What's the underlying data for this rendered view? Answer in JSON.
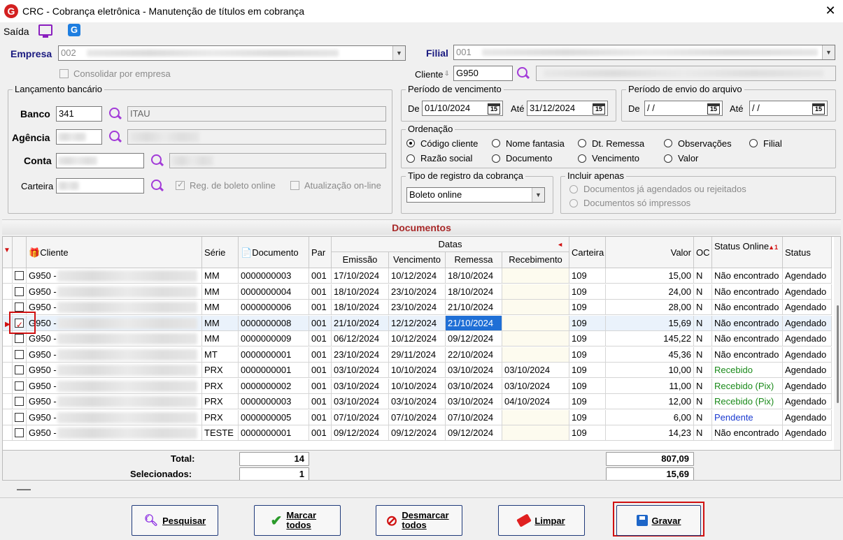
{
  "window": {
    "title": "CRC - Cobrança eletrônica - Manutenção de títulos em cobrança",
    "close": "✕"
  },
  "menu": {
    "saida": "Saída"
  },
  "empresa": {
    "label": "Empresa",
    "value": "002",
    "consolidar": "Consolidar por empresa"
  },
  "filial": {
    "label": "Filial",
    "value": "001",
    "cliente_label": "Cliente",
    "cliente_value": "G950"
  },
  "lancamento": {
    "title": "Lançamento bancário",
    "banco_label": "Banco",
    "banco": "341",
    "banco_nome": "ITAU",
    "agencia_label": "Agência",
    "conta_label": "Conta",
    "carteira_label": "Carteira",
    "reg_boleto": "Reg. de boleto online",
    "atualizacao": "Atualização on-line"
  },
  "vencimento": {
    "title": "Período de vencimento",
    "de_label": "De",
    "de": "01/10/2024",
    "ate_label": "Até",
    "ate": "31/12/2024"
  },
  "envio": {
    "title": "Período de envio do arquivo",
    "de_label": "De",
    "de": " / /",
    "ate_label": "Até",
    "ate": " / /"
  },
  "ordenacao": {
    "title": "Ordenação",
    "opts": [
      "Código cliente",
      "Nome fantasia",
      "Dt. Remessa",
      "Observações",
      "Filial",
      "Razão social",
      "Documento",
      "Vencimento",
      "Valor"
    ]
  },
  "tipo_registro": {
    "title": "Tipo de registro da cobrança",
    "value": "Boleto online"
  },
  "incluir": {
    "title": "Incluir apenas",
    "opt1": "Documentos já agendados ou rejeitados",
    "opt2": "Documentos só impressos"
  },
  "documentos": {
    "title": "Documentos"
  },
  "grid": {
    "headers": {
      "cliente": "Cliente",
      "serie": "Série",
      "documento": "Documento",
      "par": "Par",
      "datas": "Datas",
      "emissao": "Emissão",
      "vencimento": "Vencimento",
      "remessa": "Remessa",
      "recebimento": "Recebimento",
      "carteira": "Carteira",
      "valor": "Valor",
      "oc": "OC",
      "status_online": "Status Online",
      "status": "Status"
    },
    "rows": [
      {
        "cli": "G950 -",
        "serie": "MM",
        "doc": "0000000003",
        "par": "001",
        "emi": "17/10/2024",
        "ven": "10/12/2024",
        "rem": "18/10/2024",
        "rec": "",
        "car": "109",
        "val": "15,00",
        "oc": "N",
        "so": "Não encontrado",
        "st": "Agendado",
        "soc": ""
      },
      {
        "cli": "G950 -",
        "serie": "MM",
        "doc": "0000000004",
        "par": "001",
        "emi": "18/10/2024",
        "ven": "23/10/2024",
        "rem": "18/10/2024",
        "rec": "",
        "car": "109",
        "val": "24,00",
        "oc": "N",
        "so": "Não encontrado",
        "st": "Agendado",
        "soc": ""
      },
      {
        "cli": "G950 -",
        "serie": "MM",
        "doc": "0000000006",
        "par": "001",
        "emi": "18/10/2024",
        "ven": "23/10/2024",
        "rem": "21/10/2024",
        "rec": "",
        "car": "109",
        "val": "28,00",
        "oc": "N",
        "so": "Não encontrado",
        "st": "Agendado",
        "soc": ""
      },
      {
        "cli": "G950 -",
        "serie": "MM",
        "doc": "0000000008",
        "par": "001",
        "emi": "21/10/2024",
        "ven": "12/12/2024",
        "rem": "21/10/2024",
        "rec": "",
        "car": "109",
        "val": "15,69",
        "oc": "N",
        "so": "Não encontrado",
        "st": "Agendado",
        "soc": ""
      },
      {
        "cli": "G950 -",
        "serie": "MM",
        "doc": "0000000009",
        "par": "001",
        "emi": "06/12/2024",
        "ven": "10/12/2024",
        "rem": "09/12/2024",
        "rec": "",
        "car": "109",
        "val": "145,22",
        "oc": "N",
        "so": "Não encontrado",
        "st": "Agendado",
        "soc": ""
      },
      {
        "cli": "G950 -",
        "serie": "MT",
        "doc": "0000000001",
        "par": "001",
        "emi": "23/10/2024",
        "ven": "29/11/2024",
        "rem": "22/10/2024",
        "rec": "",
        "car": "109",
        "val": "45,36",
        "oc": "N",
        "so": "Não encontrado",
        "st": "Agendado",
        "soc": ""
      },
      {
        "cli": "G950 -",
        "serie": "PRX",
        "doc": "0000000001",
        "par": "001",
        "emi": "03/10/2024",
        "ven": "10/10/2024",
        "rem": "03/10/2024",
        "rec": "03/10/2024",
        "car": "109",
        "val": "10,00",
        "oc": "N",
        "so": "Recebido",
        "st": "Agendado",
        "soc": "green"
      },
      {
        "cli": "G950 -",
        "serie": "PRX",
        "doc": "0000000002",
        "par": "001",
        "emi": "03/10/2024",
        "ven": "10/10/2024",
        "rem": "03/10/2024",
        "rec": "03/10/2024",
        "car": "109",
        "val": "11,00",
        "oc": "N",
        "so": "Recebido (Pix)",
        "st": "Agendado",
        "soc": "green"
      },
      {
        "cli": "G950 -",
        "serie": "PRX",
        "doc": "0000000003",
        "par": "001",
        "emi": "03/10/2024",
        "ven": "03/10/2024",
        "rem": "03/10/2024",
        "rec": "04/10/2024",
        "car": "109",
        "val": "12,00",
        "oc": "N",
        "so": "Recebido (Pix)",
        "st": "Agendado",
        "soc": "green"
      },
      {
        "cli": "G950 -",
        "serie": "PRX",
        "doc": "0000000005",
        "par": "001",
        "emi": "07/10/2024",
        "ven": "07/10/2024",
        "rem": "07/10/2024",
        "rec": "",
        "car": "109",
        "val": "6,00",
        "oc": "N",
        "so": "Pendente",
        "st": "Agendado",
        "soc": "blue"
      },
      {
        "cli": "G950 -",
        "serie": "TESTE",
        "doc": "0000000001",
        "par": "001",
        "emi": "09/12/2024",
        "ven": "09/12/2024",
        "rem": "09/12/2024",
        "rec": "",
        "car": "109",
        "val": "14,23",
        "oc": "N",
        "so": "Não encontrado",
        "st": "Agendado",
        "soc": ""
      }
    ],
    "selected_row": 3
  },
  "totals": {
    "total_label": "Total:",
    "total_count": "14",
    "total_valor": "807,09",
    "sel_label": "Selecionados:",
    "sel_count": "1",
    "sel_valor": "15,69"
  },
  "buttons": {
    "pesquisar": "Pesquisar",
    "marcar": "Marcar todos",
    "desmarcar": "Desmarcar todos",
    "limpar": "Limpar",
    "gravar": "Gravar"
  }
}
